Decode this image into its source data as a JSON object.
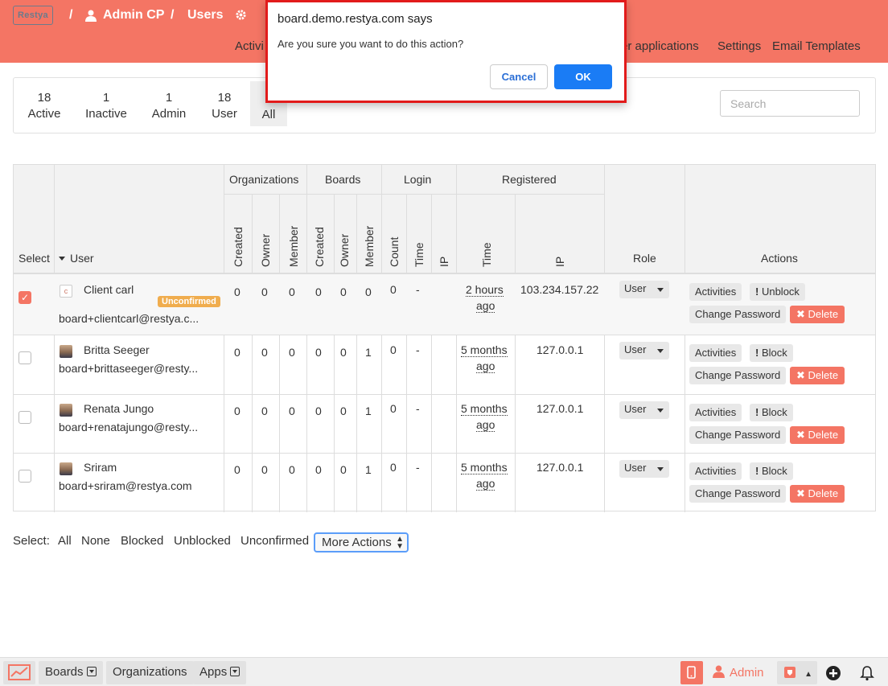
{
  "header": {
    "logo_text": "Restya",
    "crumbs": [
      "/",
      "Admin CP",
      "/",
      "Users"
    ],
    "nav": [
      "Activi",
      "er applications",
      "Settings",
      "Email Templates"
    ]
  },
  "filters": {
    "stats": [
      {
        "count": "18",
        "label": "Active"
      },
      {
        "count": "1",
        "label": "Inactive"
      },
      {
        "count": "1",
        "label": "Admin"
      },
      {
        "count": "18",
        "label": "User"
      },
      {
        "count": "",
        "label": "All"
      }
    ],
    "search_placeholder": "Search"
  },
  "table": {
    "headers": {
      "select": "Select",
      "user": "User",
      "organizations": "Organizations",
      "boards": "Boards",
      "login": "Login",
      "registered": "Registered",
      "role": "Role",
      "actions": "Actions",
      "sub": [
        "Created",
        "Owner",
        "Member",
        "Created",
        "Owner",
        "Member",
        "Count",
        "Time",
        "IP",
        "Time",
        "IP"
      ]
    },
    "rows": [
      {
        "checked": true,
        "name": "Client carl",
        "email": "board+clientcarl@restya.c...",
        "badge": "Unconfirmed",
        "avatar_initial": "c",
        "org_created": "0",
        "org_owner": "0",
        "org_member": "0",
        "board_created": "0",
        "board_owner": "0",
        "board_member": "0",
        "login_count": "0",
        "login_time": "-",
        "reg_time_1": "2 hours",
        "reg_time_2": "ago",
        "reg_ip": "103.234.157.22",
        "role": "User",
        "block_label": "Unblock"
      },
      {
        "checked": false,
        "name": "Britta Seeger",
        "email": "board+brittaseeger@resty...",
        "badge": "",
        "avatar_initial": "",
        "org_created": "0",
        "org_owner": "0",
        "org_member": "0",
        "board_created": "0",
        "board_owner": "0",
        "board_member": "1",
        "login_count": "0",
        "login_time": "-",
        "reg_time_1": "5 months",
        "reg_time_2": "ago",
        "reg_ip": "127.0.0.1",
        "role": "User",
        "block_label": "Block"
      },
      {
        "checked": false,
        "name": "Renata Jungo",
        "email": "board+renatajungo@resty...",
        "badge": "",
        "avatar_initial": "",
        "org_created": "0",
        "org_owner": "0",
        "org_member": "0",
        "board_created": "0",
        "board_owner": "0",
        "board_member": "1",
        "login_count": "0",
        "login_time": "-",
        "reg_time_1": "5 months",
        "reg_time_2": "ago",
        "reg_ip": "127.0.0.1",
        "role": "User",
        "block_label": "Block"
      },
      {
        "checked": false,
        "name": "Sriram",
        "email": "board+sriram@restya.com",
        "badge": "",
        "avatar_initial": "",
        "org_created": "0",
        "org_owner": "0",
        "org_member": "0",
        "board_created": "0",
        "board_owner": "0",
        "board_member": "1",
        "login_count": "0",
        "login_time": "-",
        "reg_time_1": "5 months",
        "reg_time_2": "ago",
        "reg_ip": "127.0.0.1",
        "role": "User",
        "block_label": "Block"
      }
    ],
    "action_labels": {
      "activities": "Activities",
      "change_password": "Change Password",
      "delete": "Delete"
    }
  },
  "select_bar": {
    "label": "Select:",
    "options": [
      "All",
      "None",
      "Blocked",
      "Unblocked",
      "Unconfirmed"
    ],
    "more_actions": "More Actions"
  },
  "footer": {
    "boards": "Boards",
    "organizations": "Organizations",
    "apps": "Apps",
    "admin": "Admin"
  },
  "dialog": {
    "title": "board.demo.restya.com says",
    "message": "Are you sure you want to do this action?",
    "cancel": "Cancel",
    "ok": "OK"
  },
  "colors": {
    "brand": "#f47564",
    "dialog_border": "#e21b1b",
    "ok_button": "#1a7cf5",
    "badge": "#f0ad4e"
  }
}
